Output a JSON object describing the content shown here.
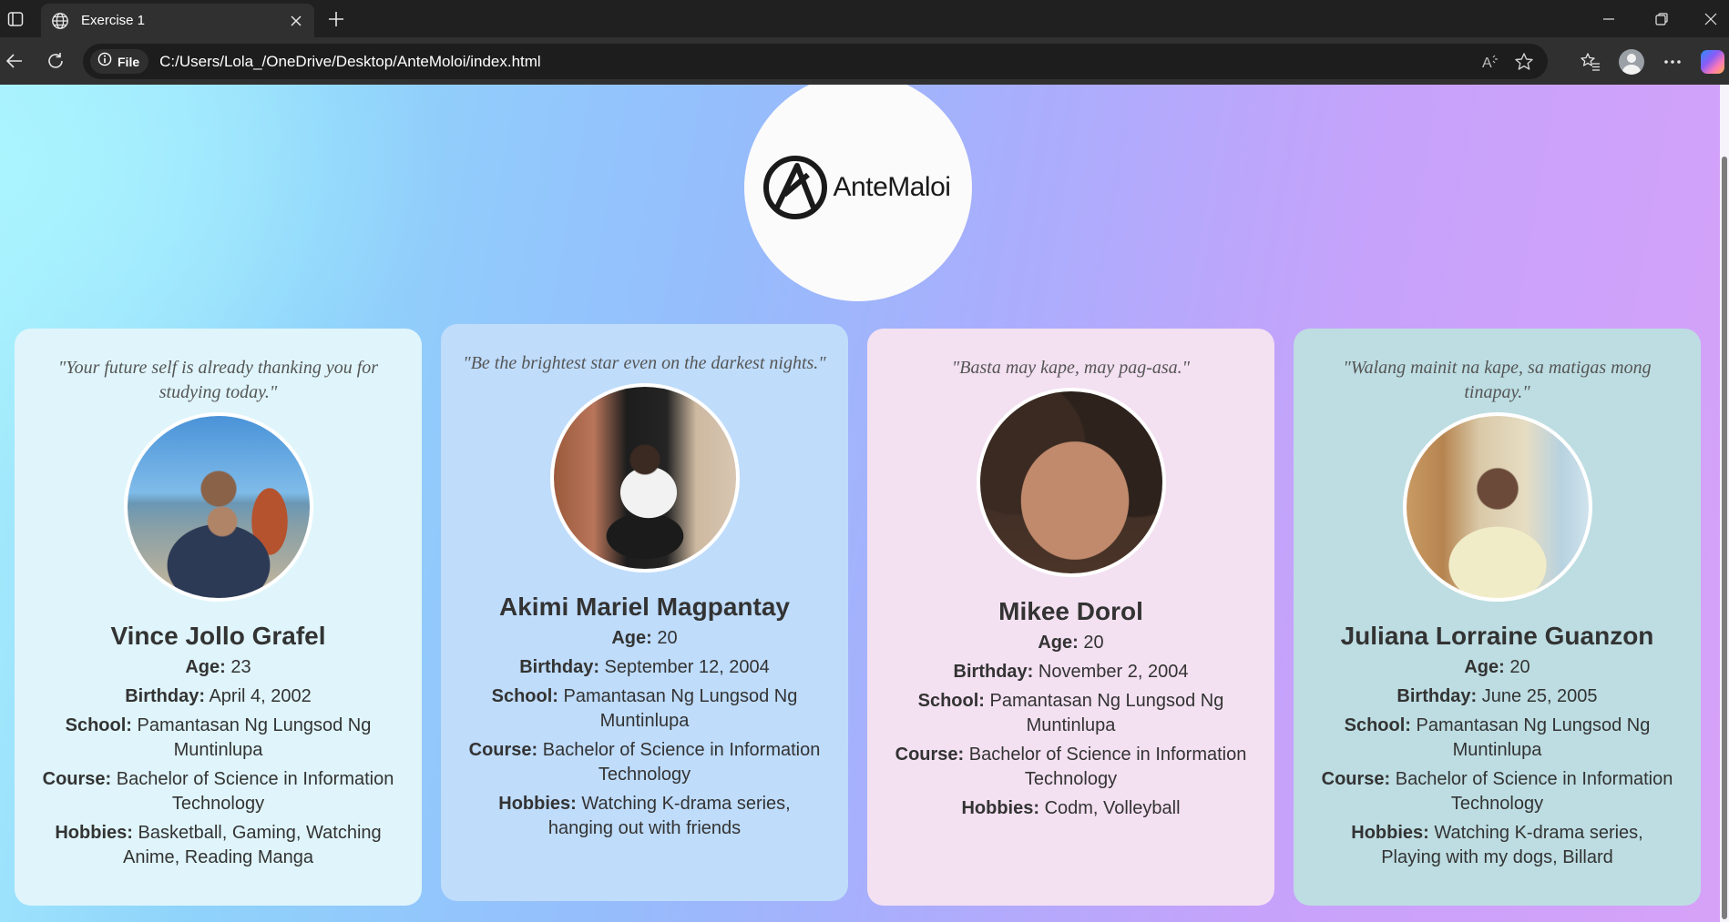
{
  "browser": {
    "tab_title": "Exercise 1",
    "site_info_label": "File",
    "url": "C:/Users/Lola_/OneDrive/Desktop/AnteMoloi/index.html"
  },
  "page": {
    "logo_text": "AnteMaloi",
    "cards": [
      {
        "quote": "\"Your future self is already thanking you for studying today.\"",
        "name": "Vince Jollo Grafel",
        "age_label": "Age:",
        "age": " 23",
        "birthday_label": "Birthday:",
        "birthday": " April 4, 2002",
        "school_label": "School:",
        "school": " Pamantasan Ng Lungsod Ng Muntinlupa",
        "course_label": "Course:",
        "course": " Bachelor of Science in Information Technology",
        "hobbies_label": "Hobbies:",
        "hobbies": " Basketball, Gaming, Watching Anime, Reading Manga",
        "bg": "#dff5fb"
      },
      {
        "quote": "\"Be the brightest star even on the darkest nights.\"",
        "name": "Akimi Mariel Magpantay",
        "age_label": "Age:",
        "age": " 20",
        "birthday_label": "Birthday:",
        "birthday": " September 12, 2004",
        "school_label": "School:",
        "school": " Pamantasan Ng Lungsod Ng Muntinlupa",
        "course_label": "Course:",
        "course": " Bachelor of Science in Information Technology",
        "hobbies_label": "Hobbies:",
        "hobbies": " Watching K-drama series, hanging out with friends",
        "bg": "#bfdcfb"
      },
      {
        "quote": "\"Basta may kape, may pag-asa.\"",
        "name": "Mikee Dorol",
        "age_label": "Age:",
        "age": " 20",
        "birthday_label": "Birthday:",
        "birthday": " November 2, 2004",
        "school_label": "School:",
        "school": " Pamantasan Ng Lungsod Ng Muntinlupa",
        "course_label": "Course:",
        "course": " Bachelor of Science in Information Technology",
        "hobbies_label": "Hobbies:",
        "hobbies": " Codm, Volleyball",
        "bg": "#f3e0f1"
      },
      {
        "quote": "\"Walang mainit na kape, sa matigas mong tinapay.\"",
        "name": "Juliana Lorraine Guanzon",
        "age_label": "Age:",
        "age": " 20",
        "birthday_label": "Birthday:",
        "birthday": " June 25, 2005",
        "school_label": "School:",
        "school": " Pamantasan Ng Lungsod Ng Muntinlupa",
        "course_label": "Course:",
        "course": " Bachelor of Science in Information Technology",
        "hobbies_label": "Hobbies:",
        "hobbies": " Watching K-drama series, Playing with my dogs, Billard",
        "bg": "#bddde2"
      }
    ]
  },
  "icons": {
    "tab_actions": "tab-actions-icon",
    "favicon": "globe-icon",
    "close": "close-icon",
    "new_tab": "plus-icon",
    "back": "back-arrow-icon",
    "refresh": "refresh-icon",
    "info": "info-icon",
    "read_aloud": "read-aloud-icon",
    "favorite": "star-icon",
    "favorites": "favorites-icon",
    "profile": "profile-icon",
    "menu": "more-icon",
    "copilot": "copilot-icon"
  }
}
